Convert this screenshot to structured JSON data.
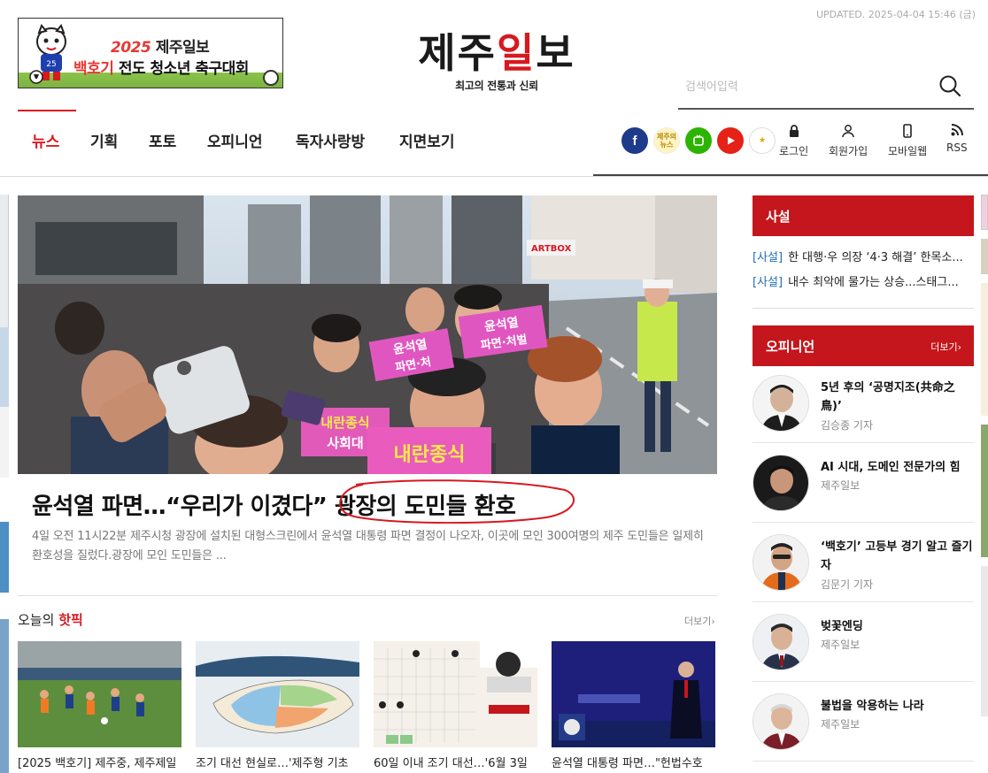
{
  "header": {
    "updated": "UPDATED. 2025-04-04 15:46 (금)",
    "banner": {
      "year": "2025",
      "line1": "제주일보",
      "line2_highlight": "백호기",
      "line2": "전도 청소년 축구대회"
    },
    "logo": {
      "part1": "제주",
      "part2": "일",
      "part3": "보",
      "tagline": "최고의 전통과 신뢰"
    },
    "search": {
      "placeholder": "검색어입력",
      "icon": "search-icon"
    }
  },
  "nav": {
    "items": [
      {
        "label": "뉴스",
        "active": true
      },
      {
        "label": "기획"
      },
      {
        "label": "포토"
      },
      {
        "label": "오피니언"
      },
      {
        "label": "독자사랑방"
      },
      {
        "label": "지면보기"
      }
    ]
  },
  "social": {
    "facebook": "f",
    "news": "제주의\n뉴스",
    "tv": "tv-icon",
    "youtube": "youtube-icon",
    "extra": "extra-icon"
  },
  "util": {
    "login": "로그인",
    "signup": "회원가입",
    "mobile": "모바일웹",
    "rss": "RSS"
  },
  "main_story": {
    "headline": "윤석열 파면…“우리가 이겼다” 광장의 도민들 환호",
    "summary": "4일 오전 11시22분 제주시청 광장에 설치된 대형스크린에서 윤석열 대통령 파면 결정이 나오자, 이곳에 모인 300여명의 제주 도민들은 일제히 환호성을 질렀다.광장에 모인 도민들은 ...",
    "image": {
      "sign1_line1": "윤석열",
      "sign1_line2": "파면·처벌",
      "sign2_line1": "윤석열",
      "sign2_line2": "파면·처",
      "sign3_line1": "내란종식",
      "sign3_line2": "사회대",
      "sign4": "내란종식",
      "shop_sign": "ARTBOX"
    }
  },
  "hot_picks": {
    "title_prefix": "오늘의",
    "title_highlight": "핫픽",
    "more": "더보기›",
    "items": [
      {
        "caption": "[2025 백호기] 제주중, 제주제일"
      },
      {
        "caption": "조기 대선 현실로…'제주형 기초"
      },
      {
        "caption": "60일 이내 조기 대선…'6월 3일"
      },
      {
        "caption": "윤석열 대통령 파면…\"헌법수호"
      }
    ]
  },
  "editorial": {
    "title": "사설",
    "items": [
      {
        "tag": "[사설]",
        "text": "한 대행·우 의장 ‘4·3 해결’ 한목소..."
      },
      {
        "tag": "[사설]",
        "text": "내수 최악에 물가는 상승...스태그..."
      }
    ]
  },
  "opinion": {
    "title": "오피니언",
    "more": "더보기›",
    "items": [
      {
        "title": "5년 후의 ‘공명지조(共命之鳥)’",
        "author": "김승종 기자"
      },
      {
        "title": "AI 시대, 도메인 전문가의 힘",
        "author": "제주일보"
      },
      {
        "title": "‘백호기’ 고등부 경기 알고 즐기자",
        "author": "김문기 기자"
      },
      {
        "title": "벚꽃엔딩",
        "author": "제주일보"
      },
      {
        "title": "불법을 악용하는 나라",
        "author": "제주일보"
      }
    ]
  },
  "colors": {
    "brand_red": "#c4161c",
    "active_red": "#d71920",
    "tag_blue": "#1f6fb5"
  }
}
